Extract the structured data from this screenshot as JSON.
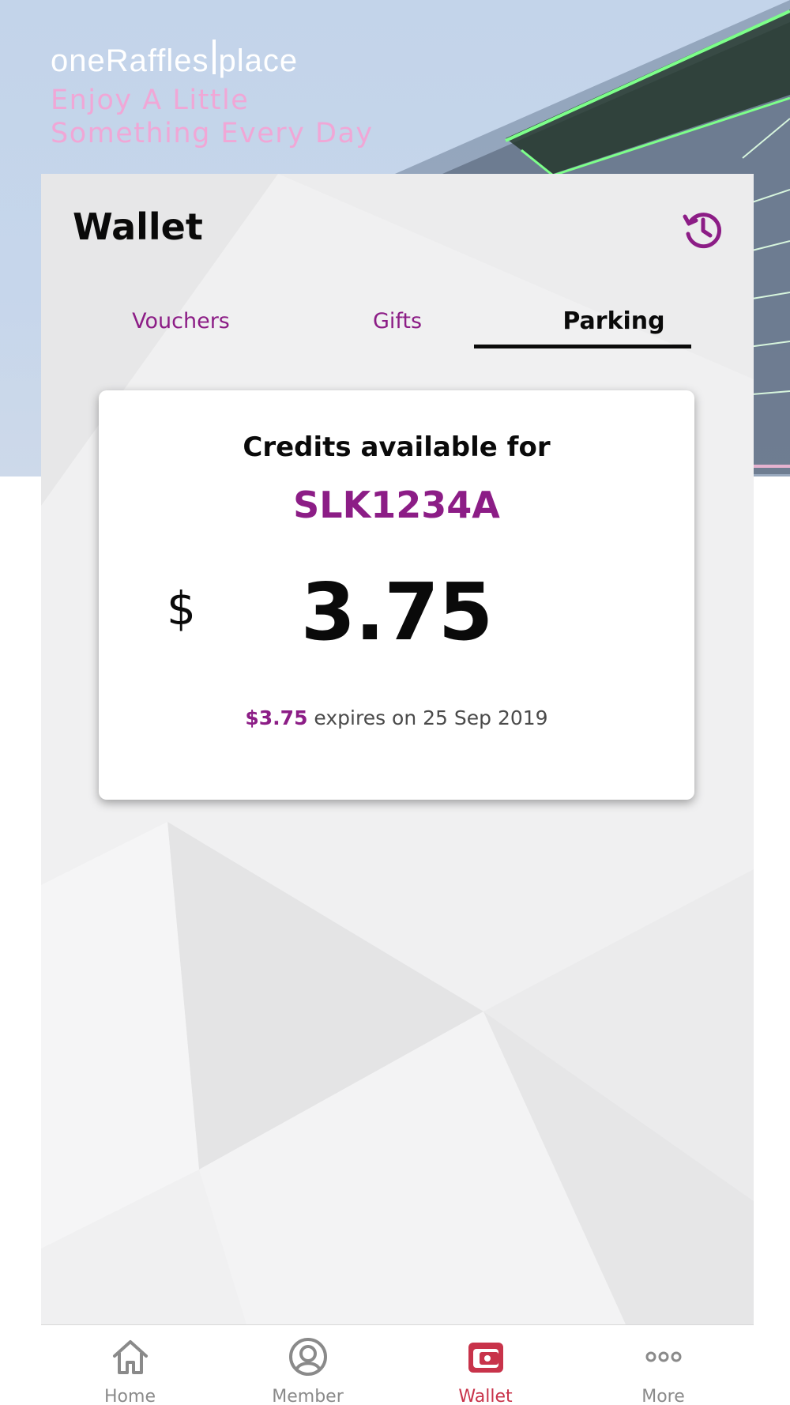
{
  "brand": {
    "logo_text": "oneRaffles",
    "logo_text_2": "place",
    "tagline_line1": "Enjoy A Little",
    "tagline_line2": "Something Every Day"
  },
  "header": {
    "title": "Wallet",
    "history_icon": "history-icon"
  },
  "tabs": [
    {
      "label": "Vouchers",
      "active": false
    },
    {
      "label": "Gifts",
      "active": false
    },
    {
      "label": "Parking",
      "active": true
    }
  ],
  "credits": {
    "title": "Credits available for",
    "plate": "SLK1234A",
    "currency": "$",
    "amount": "3.75",
    "expiry_amount": "$3.75",
    "expiry_text": " expires on 25 Sep 2019"
  },
  "bottom_nav": [
    {
      "label": "Home",
      "icon": "home-icon",
      "active": false
    },
    {
      "label": "Member",
      "icon": "member-icon",
      "active": false
    },
    {
      "label": "Wallet",
      "icon": "wallet-icon",
      "active": true
    },
    {
      "label": "More",
      "icon": "more-icon",
      "active": false
    }
  ],
  "colors": {
    "accent": "#8c1d86",
    "nav_active": "#c8334a",
    "nav_inactive": "#8a8a8a",
    "tagline": "#f0a7d6",
    "hero_sky": "#c3d4ea"
  }
}
